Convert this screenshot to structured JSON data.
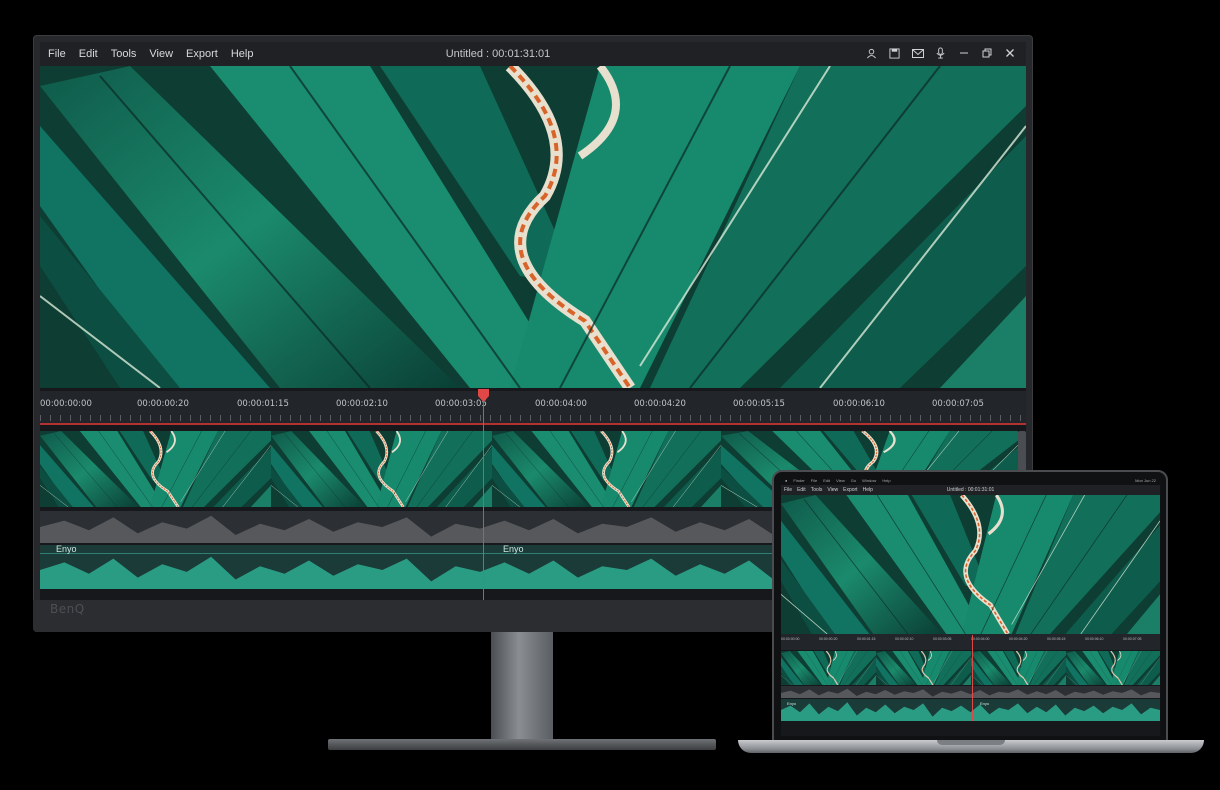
{
  "app": {
    "menu": [
      "File",
      "Edit",
      "Tools",
      "View",
      "Export",
      "Help"
    ],
    "title": "Untitled : 00:01:31:01",
    "title_icons": [
      "user-icon",
      "save-icon",
      "mail-icon",
      "microphone-icon",
      "minimize-icon",
      "restore-icon",
      "close-icon"
    ]
  },
  "timeline": {
    "ticks": [
      "00:00:00:00",
      "00:00:00:20",
      "00:00:01:15",
      "00:00:02:10",
      "00:00:03:05",
      "00:00:04:00",
      "00:00:04:20",
      "00:00:05:15",
      "00:00:06:10",
      "00:00:07:05"
    ],
    "playhead_time": "00:00:03:05",
    "audio_labels": [
      "Enyo",
      "Enyo"
    ]
  },
  "monitor": {
    "brand": "BenQ"
  },
  "laptop": {
    "os_menu": [
      "Finder",
      "File",
      "Edit",
      "View",
      "Go",
      "Window",
      "Help"
    ],
    "os_time": "Mon Jun 22",
    "menu": [
      "File",
      "Edit",
      "Tools",
      "View",
      "Export",
      "Help"
    ],
    "title": "Untitled : 00:01:31:01",
    "ticks": [
      "00:00:00:00",
      "00:00:00:20",
      "00:00:01:15",
      "00:00:02:10",
      "00:00:03:05",
      "00:00:04:00",
      "00:00:04:20",
      "00:00:05:15",
      "00:00:06:10",
      "00:00:07:05"
    ],
    "audio_labels": [
      "Enyo",
      "Enyo"
    ]
  },
  "colors": {
    "accent_green": "#1f8a70",
    "playhead_red": "#e04848",
    "leaf_orange": "#d8642a"
  }
}
